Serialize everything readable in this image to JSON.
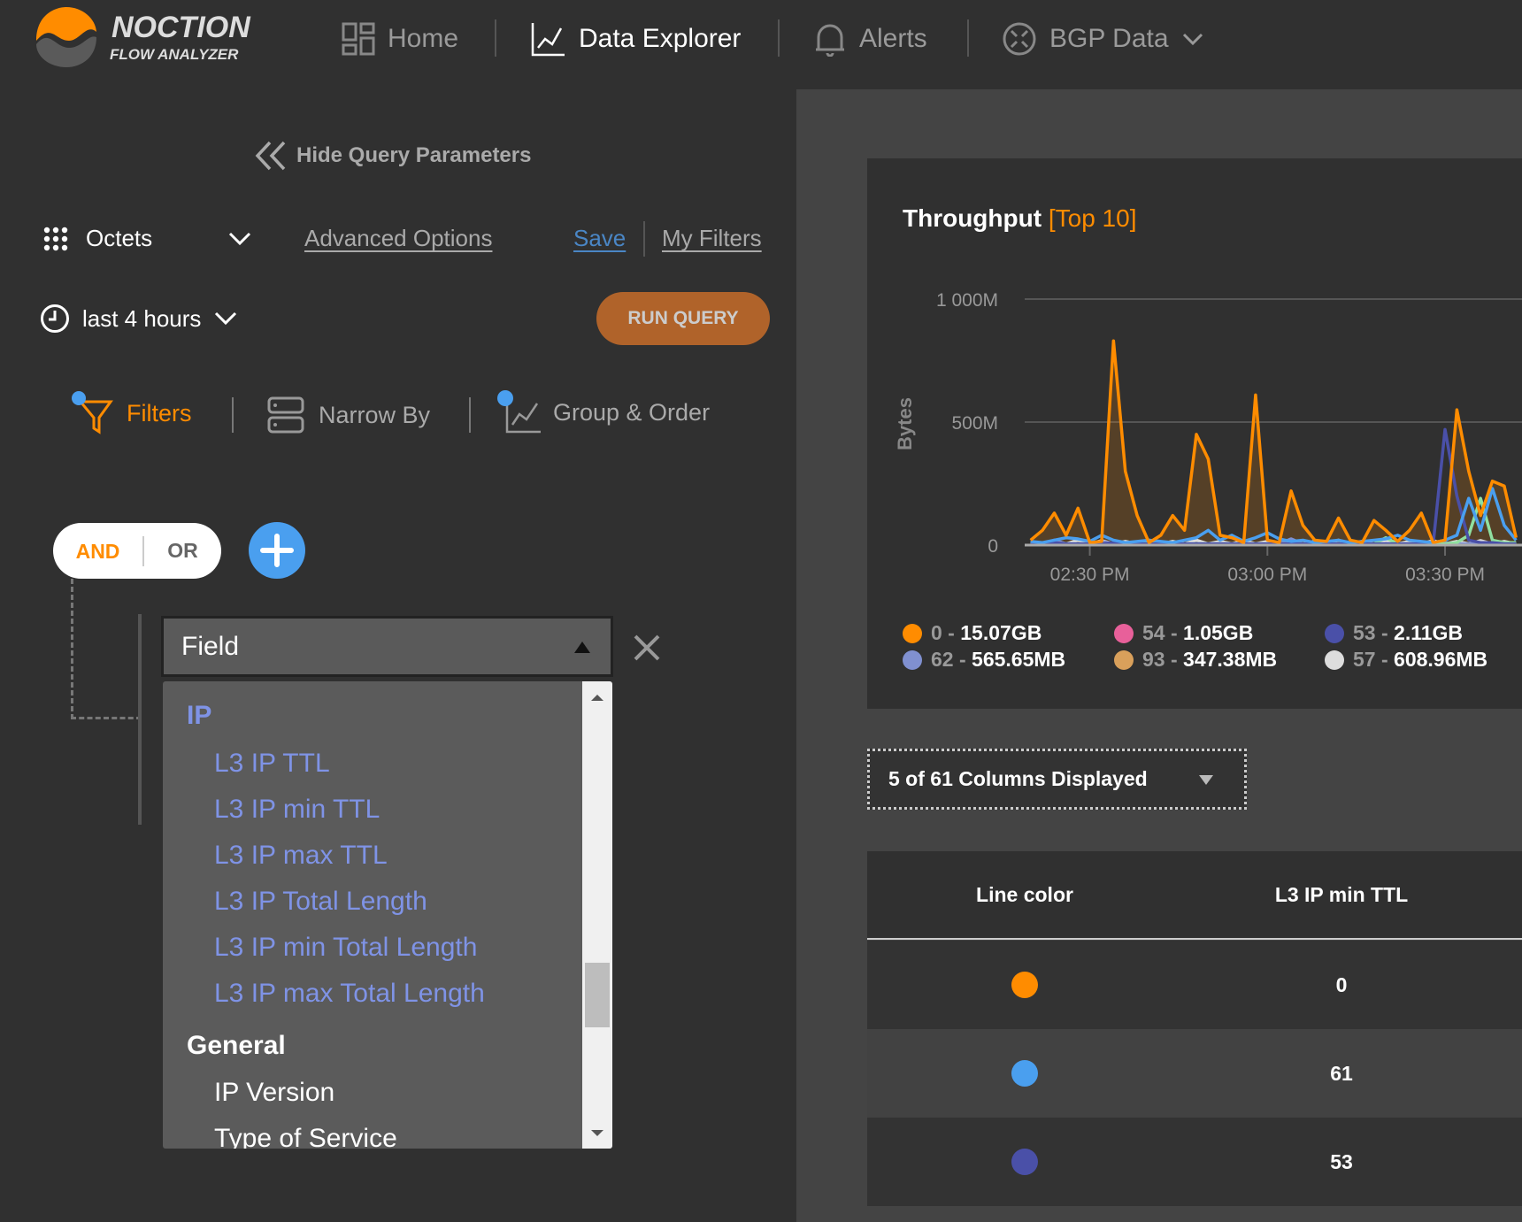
{
  "header": {
    "logo_title": "NOCTION",
    "logo_subtitle": "FLOW ANALYZER",
    "nav": [
      {
        "label": "Home",
        "icon": "dashboard-grid-icon"
      },
      {
        "label": "Data Explorer",
        "icon": "line-chart-icon",
        "active": true
      },
      {
        "label": "Alerts",
        "icon": "bell-icon"
      },
      {
        "label": "BGP Data",
        "icon": "bgp-network-icon"
      }
    ]
  },
  "query": {
    "hide_label": "Hide Query Parameters",
    "metric": "Octets",
    "advanced_options": "Advanced Options",
    "save": "Save",
    "my_filters": "My Filters",
    "time_range": "last 4 hours",
    "run_query": "RUN QUERY",
    "tabs": [
      {
        "label": "Filters",
        "active": true
      },
      {
        "label": "Narrow By"
      },
      {
        "label": "Group & Order"
      }
    ],
    "and_label": "AND",
    "or_label": "OR",
    "logic_selected": "AND",
    "field_select": {
      "value": "Field",
      "options": [
        {
          "label": "IP",
          "group": true
        },
        {
          "label": "L3 IP TTL"
        },
        {
          "label": "L3 IP min TTL"
        },
        {
          "label": "L3 IP max TTL"
        },
        {
          "label": "L3 IP Total Length"
        },
        {
          "label": "L3 IP min Total Length"
        },
        {
          "label": "L3 IP max Total Length"
        },
        {
          "label": "General",
          "group": true
        },
        {
          "label": "IP Version"
        },
        {
          "label": "Type of Service"
        }
      ]
    }
  },
  "colors": {
    "accent": "#ff8c00",
    "link": "#4a86c5",
    "option": "#7f93e6",
    "run": "#b0632a"
  },
  "chart_data": {
    "type": "line",
    "title": "Throughput",
    "title_tag": "[Top 10]",
    "ylabel": "Bytes",
    "ylim": [
      0,
      1000
    ],
    "yticks": [
      "0",
      "500M",
      "1 000M"
    ],
    "ytick_values": [
      0,
      500,
      1000
    ],
    "xticks": [
      "02:30 PM",
      "03:00 PM",
      "03:30 PM"
    ],
    "xtick_values": [
      "14:30",
      "15:00",
      "15:30"
    ],
    "xlim": [
      "14:19",
      "15:43"
    ],
    "grid": true,
    "unit": "M bytes",
    "x": [
      "14:20",
      "14:22",
      "14:24",
      "14:26",
      "14:28",
      "14:30",
      "14:32",
      "14:34",
      "14:36",
      "14:38",
      "14:40",
      "14:42",
      "14:44",
      "14:46",
      "14:48",
      "14:50",
      "14:52",
      "14:54",
      "14:56",
      "14:58",
      "15:00",
      "15:02",
      "15:04",
      "15:06",
      "15:08",
      "15:10",
      "15:12",
      "15:14",
      "15:16",
      "15:18",
      "15:20",
      "15:22",
      "15:24",
      "15:26",
      "15:28",
      "15:30",
      "15:32",
      "15:34",
      "15:36",
      "15:38",
      "15:40",
      "15:42"
    ],
    "series": [
      {
        "name": "0",
        "color": "#ff8c00",
        "fill": true,
        "values": [
          20,
          60,
          130,
          40,
          150,
          10,
          15,
          830,
          300,
          120,
          10,
          40,
          120,
          60,
          450,
          350,
          40,
          30,
          10,
          610,
          20,
          10,
          220,
          80,
          20,
          15,
          110,
          20,
          10,
          100,
          60,
          15,
          60,
          130,
          10,
          20,
          550,
          300,
          120,
          260,
          240,
          30
        ]
      },
      {
        "name": "61",
        "color": "#4a9fef",
        "values": [
          15,
          10,
          20,
          30,
          25,
          15,
          40,
          20,
          10,
          15,
          20,
          15,
          10,
          20,
          30,
          60,
          20,
          40,
          15,
          30,
          50,
          25,
          15,
          20,
          10,
          15,
          20,
          10,
          15,
          20,
          25,
          40,
          20,
          15,
          10,
          20,
          40,
          190,
          60,
          230,
          80,
          20
        ]
      },
      {
        "name": "53",
        "color": "#4a50a8",
        "values": [
          5,
          5,
          10,
          5,
          5,
          5,
          5,
          10,
          5,
          5,
          5,
          5,
          5,
          5,
          5,
          5,
          5,
          5,
          5,
          5,
          5,
          5,
          5,
          5,
          5,
          5,
          5,
          5,
          5,
          5,
          5,
          5,
          5,
          5,
          5,
          470,
          200,
          20,
          10,
          10,
          5,
          5
        ]
      },
      {
        "color": "#90e0a0",
        "values": [
          5,
          5,
          5,
          5,
          5,
          5,
          5,
          5,
          10,
          5,
          20,
          5,
          5,
          5,
          5,
          5,
          5,
          5,
          5,
          5,
          5,
          5,
          5,
          5,
          5,
          5,
          5,
          5,
          5,
          5,
          30,
          5,
          5,
          5,
          5,
          5,
          10,
          40,
          190,
          20,
          10,
          10
        ]
      },
      {
        "name": "62",
        "color": "#8090d0",
        "values": [
          5,
          5,
          20,
          5,
          5,
          5,
          15,
          5,
          5,
          5,
          5,
          10,
          5,
          5,
          5,
          5,
          5,
          5,
          5,
          5,
          5,
          5,
          25,
          5,
          5,
          5,
          5,
          5,
          5,
          5,
          5,
          5,
          5,
          5,
          5,
          10,
          5,
          5,
          5,
          5,
          5,
          5
        ]
      },
      {
        "name": "57",
        "color": "#dddddd",
        "values": [
          15,
          5,
          18,
          5,
          20,
          5,
          18,
          5,
          15,
          5,
          18,
          5,
          15,
          5,
          20,
          5,
          15,
          5,
          18,
          5,
          15,
          5,
          18,
          5,
          15,
          5,
          20,
          5,
          15,
          5,
          18,
          5,
          15,
          5,
          18,
          5,
          15,
          5,
          18,
          5,
          15,
          5
        ]
      },
      {
        "name": "93",
        "color": "#d9a05b",
        "values": [
          3,
          3,
          3,
          3,
          3,
          3,
          3,
          3,
          3,
          3,
          3,
          3,
          3,
          3,
          3,
          3,
          3,
          3,
          3,
          3,
          3,
          3,
          3,
          3,
          3,
          3,
          3,
          3,
          3,
          3,
          3,
          3,
          3,
          3,
          3,
          3,
          3,
          3,
          3,
          3,
          3,
          3
        ]
      },
      {
        "name": "54",
        "color": "#e8609a",
        "values": [
          2,
          2,
          2,
          2,
          2,
          2,
          2,
          2,
          2,
          2,
          2,
          2,
          2,
          2,
          2,
          2,
          2,
          2,
          2,
          2,
          2,
          2,
          2,
          2,
          2,
          2,
          2,
          2,
          2,
          2,
          2,
          2,
          2,
          2,
          2,
          2,
          2,
          2,
          2,
          2,
          2,
          2
        ]
      }
    ],
    "legend": [
      {
        "key": "0",
        "value": "15.07GB",
        "color": "#ff8c00"
      },
      {
        "key": "54",
        "value": "1.05GB",
        "color": "#e8609a"
      },
      {
        "key": "53",
        "value": "2.11GB",
        "color": "#4a50a8"
      },
      {
        "key": "62",
        "value": "565.65MB",
        "color": "#8090d0"
      },
      {
        "key": "93",
        "value": "347.38MB",
        "color": "#d9a05b"
      },
      {
        "key": "57",
        "value": "608.96MB",
        "color": "#dddddd"
      }
    ],
    "legend_placement": "bottom"
  },
  "columns": {
    "label": "5 of 61 Columns Displayed"
  },
  "table": {
    "headers": [
      "Line color",
      "L3 IP min TTL"
    ],
    "rows": [
      {
        "color": "#ff8c00",
        "value": "0"
      },
      {
        "color": "#4a9fef",
        "value": "61"
      },
      {
        "color": "#4a50a8",
        "value": "53"
      }
    ]
  }
}
